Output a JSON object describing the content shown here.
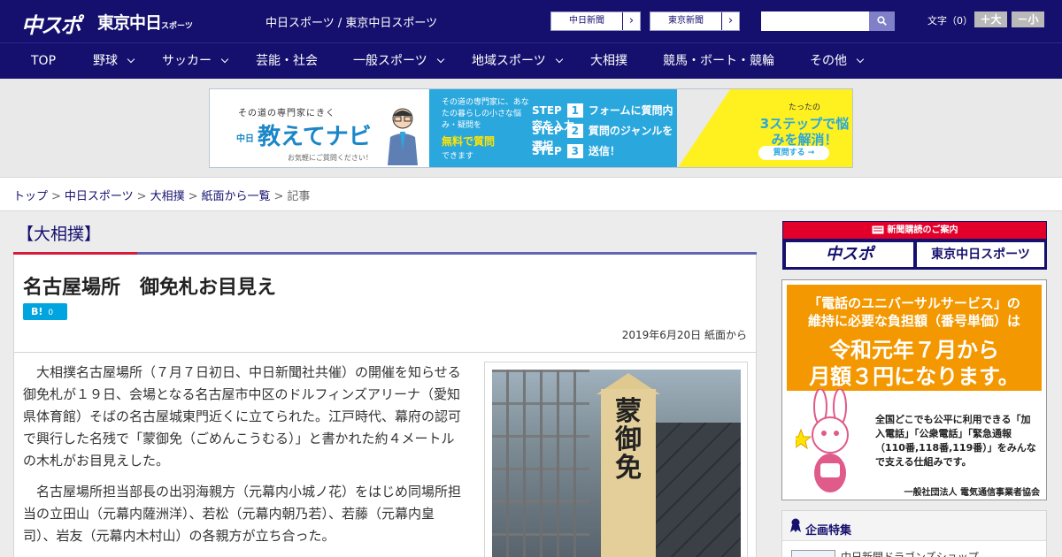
{
  "header": {
    "logo_chuspo": "中スポ",
    "logo_tokyo": "東京中日",
    "logo_tokyo_suffix": "スポーツ",
    "site_title": "中日スポーツ / 東京中日スポーツ",
    "link_chunichi": "中日新聞",
    "link_tokyo": "東京新聞",
    "link_arrow": "›",
    "search_placeholder": "",
    "font_size_label": "文字（0）",
    "font_larger": "＋大",
    "font_smaller": "－小"
  },
  "nav": {
    "items": [
      {
        "label": "TOP"
      },
      {
        "label": "野球"
      },
      {
        "label": "サッカー"
      },
      {
        "label": "芸能・社会"
      },
      {
        "label": "一般スポーツ"
      },
      {
        "label": "地域スポーツ"
      },
      {
        "label": "大相撲"
      },
      {
        "label": "競馬・ボート・競輪"
      },
      {
        "label": "その他"
      }
    ]
  },
  "banner": {
    "tagline": "その道の専門家にきく",
    "brand": "教えてナビ",
    "brand_prefix": "中日",
    "cta_small": "お気軽にご質問ください！",
    "desc": "その道の専門家に、あなたの暮らしの小さな悩み・疑問を",
    "free": "無料で質問",
    "free_suffix": "できます",
    "steps": [
      {
        "n": "1",
        "text": "フォームに質問内容を入力"
      },
      {
        "n": "2",
        "text": "質問のジャンルを選択"
      },
      {
        "n": "3",
        "text": "送信！"
      }
    ],
    "step_label": "STEP",
    "three_small": "たったの",
    "three": "3ステップで悩みを解消！",
    "ask": "質問する →"
  },
  "breadcrumb": {
    "items": [
      "トップ",
      "中日スポーツ",
      "大相撲",
      "紙面から一覧"
    ],
    "current": "記事",
    "sep": ">"
  },
  "article": {
    "category": "【大相撲】",
    "title": "名古屋場所　御免札お目見え",
    "hatena_label": "B!",
    "hatena_count": "0",
    "date_source": "2019年6月20日 紙面から",
    "paragraphs": [
      "大相撲名古屋場所（７月７日初日、中日新聞社共催）の開催を知らせる御免札が１９日、会場となる名古屋市中区のドルフィンズアリーナ（愛知県体育館）そばの名古屋城東門近くに立てられた。江戸時代、幕府の認可で興行した名残で「蒙御免（ごめんこうむる）」と書かれた約４メートルの木札がお目見えした。",
      "名古屋場所担当部長の出羽海親方（元幕内小城ノ花）をはじめ同場所担当の立田山（元幕内薩洲洋）、若松（元幕内朝乃若）、若藤（元幕内皇司）、岩友（元幕内木村山）の各親方が立ち合った。"
    ],
    "photo_text": "蒙御免"
  },
  "sidebar": {
    "subscribe_head": "新聞購読のご案内",
    "subscribe_chuspo": "中スポ",
    "subscribe_tokyo": "東京中日スポーツ",
    "ad_line1": "「電話のユニバーサルサービス」の",
    "ad_line2": "維持に必要な負担額（番号単価）は",
    "ad_line3": "令和元年７月から",
    "ad_line4": "月額３円になります。",
    "ad_desc": "全国どこでも公平に利用できる「加入電話」「公衆電話」「緊急通報（110番,118番,119番）」をみんなで支える仕組みです。",
    "ad_org": "一般社団法人 電気通信事業者協会",
    "feature_title": "企画特集",
    "feature_item": "中日新聞ドラゴンズショップ"
  },
  "colors": {
    "navy": "#15106e",
    "accent_red": "#d61a3b",
    "hatena_blue": "#00a4de",
    "ad_orange": "#f39800"
  }
}
